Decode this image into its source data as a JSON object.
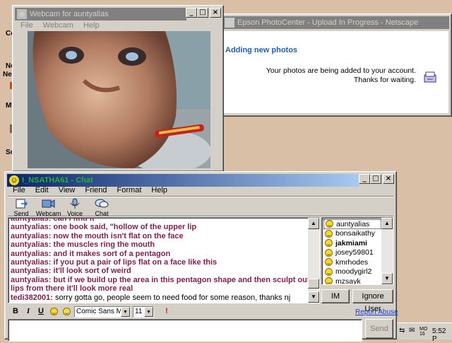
{
  "desktop": {
    "left_labels": [
      "Co",
      "Ne",
      "Nei",
      "My",
      "So"
    ]
  },
  "webcam": {
    "title": "Webcam for auntyalias",
    "menus": [
      "File",
      "Webcam",
      "Help"
    ]
  },
  "epson": {
    "title": "Epson PhotoCenter - Upload In Progress - Netscape",
    "heading": "Adding new photos",
    "line1": "Your photos are being added to your account.",
    "line2": "Thanks for waiting."
  },
  "chat": {
    "title": "I_NSATHA61 - Chat",
    "menus": [
      "File",
      "Edit",
      "View",
      "Friend",
      "Format",
      "Help"
    ],
    "toolbar": [
      {
        "label": "Send File",
        "icon": "send-file-icon"
      },
      {
        "label": "Webcam",
        "icon": "webcam-icon"
      },
      {
        "label": "Voice",
        "icon": "microphone-icon"
      },
      {
        "label": "Chat",
        "icon": "chat-bubble-icon"
      }
    ],
    "messages": [
      {
        "user": "auntyalias:",
        "text": " can i find it"
      },
      {
        "user": "auntyalias:",
        "text": " one book said, \"hollow of the upper lip"
      },
      {
        "user": "auntyalias:",
        "text": " now the mouth isn't flat on the face"
      },
      {
        "user": "auntyalias:",
        "text": " the muscles ring the mouth"
      },
      {
        "user": "auntyalias:",
        "text": " and it makes sort of a pentagon"
      },
      {
        "user": "auntyalias:",
        "text": " if you put a pair of lips flat on a face like this"
      },
      {
        "user": "auntyalias:",
        "text": " it'll look sort of weird"
      },
      {
        "user": "auntyalias:",
        "text": " but if we build up the area in this pentagon shape and then sculpt out"
      },
      {
        "user": "",
        "text": " lips from there it'll look more real"
      },
      {
        "user": "tedi382001:",
        "text": " sorry gotta go, people seem to need food for some reason, thanks nj"
      }
    ],
    "buddies": [
      "auntyalias",
      "bonsaikathy",
      "jakmiami",
      "josey59801",
      "kmrhodes",
      "moodygirl2",
      "mzsayk"
    ],
    "im_label": "IM",
    "ignore_label": "Ignore User",
    "report_abuse": "Report Abuse",
    "font_name": "Comic Sans MS",
    "font_size": "11",
    "send_label": "Send",
    "input_value": ""
  },
  "taskbar": {
    "date": "MO 16",
    "time": "5:52 P"
  }
}
